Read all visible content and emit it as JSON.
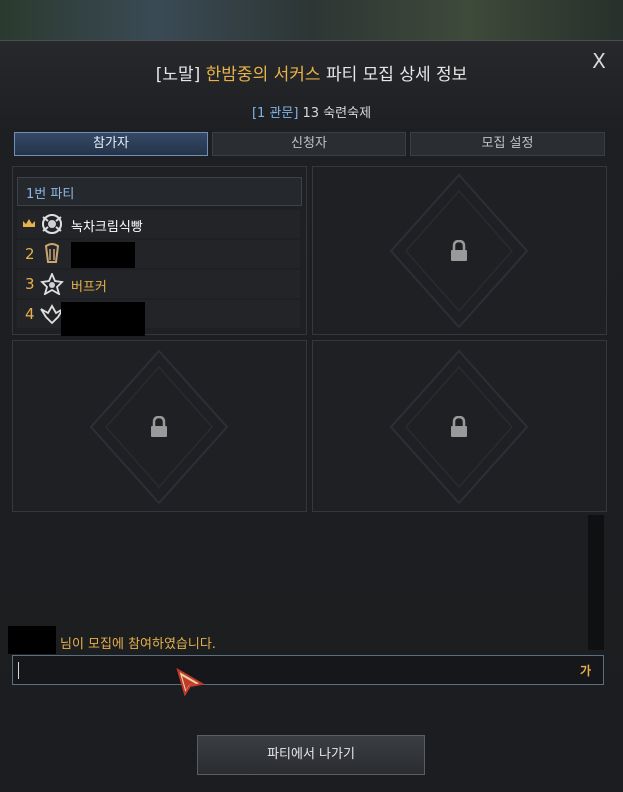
{
  "dialog": {
    "title_prefix": "[노말] ",
    "title_highlight": "한밤중의 서커스",
    "title_suffix": " 파티 모집 상세 정보",
    "subtitle_tag": "[1 관문]",
    "subtitle_text": " 13 숙련숙제",
    "close_label": "X"
  },
  "tabs": [
    {
      "label": "참가자",
      "active": true
    },
    {
      "label": "신청자",
      "active": false
    },
    {
      "label": "모집 설정",
      "active": false
    }
  ],
  "party1": {
    "header": "1번 파티",
    "members": [
      {
        "number": "",
        "leader": true,
        "name": "녹차크림식빵",
        "name_color": "#ffffff"
      },
      {
        "number": "2",
        "leader": false,
        "name": "",
        "name_color": "#ffffff"
      },
      {
        "number": "3",
        "leader": false,
        "name": "버프커",
        "name_color": "#e6b14a"
      },
      {
        "number": "4",
        "leader": false,
        "name": "",
        "name_color": "#ffffff"
      }
    ]
  },
  "chat": {
    "message": "님이 모집에 참여하였습니다.",
    "input_value": "",
    "ime_indicator": "가"
  },
  "leave_button": "파티에서 나가기",
  "colors": {
    "accent": "#e6b14a",
    "tag_blue": "#7fb4e6",
    "party_header_blue": "#8fb8e8"
  }
}
